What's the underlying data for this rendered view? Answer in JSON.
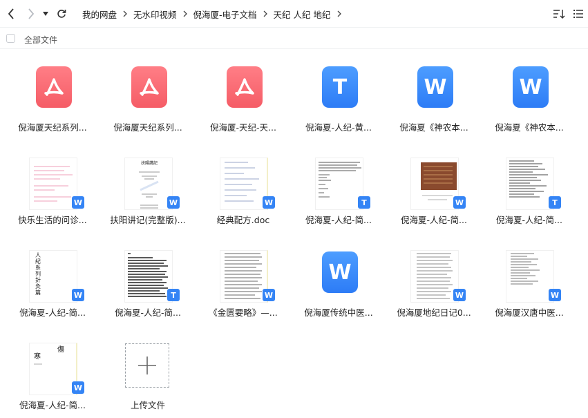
{
  "breadcrumbs": [
    "我的网盘",
    "无水印视频",
    "倪海厦-电子文档",
    "天纪 人纪 地纪"
  ],
  "select_all_label": "全部文件",
  "files": [
    {
      "name": "倪海厦天纪系列...",
      "icon": "pdf-icon"
    },
    {
      "name": "倪海厦天纪系列...",
      "icon": "pdf-icon"
    },
    {
      "name": "倪海厦-天纪-天...",
      "icon": "pdf-icon"
    },
    {
      "name": "倪海夏-人纪-黄...",
      "icon": "txt-icon"
    },
    {
      "name": "倪海夏《神农本...",
      "icon": "word-icon"
    },
    {
      "name": "倪海夏《神农本...",
      "icon": "word-icon"
    },
    {
      "name": "快乐生活的问诊...",
      "icon": "word-badge"
    },
    {
      "name": "扶阳讲记(完整版)...",
      "icon": "word-badge"
    },
    {
      "name": "经典配方.doc",
      "icon": "word-badge"
    },
    {
      "name": "倪海夏-人纪-简...",
      "icon": "txt-badge"
    },
    {
      "name": "倪海夏-人纪-简...",
      "icon": "word-badge"
    },
    {
      "name": "倪海夏-人纪-简...",
      "icon": "txt-badge"
    },
    {
      "name": "倪海夏-人纪-简...",
      "icon": "word-badge"
    },
    {
      "name": "倪海夏-人纪-简...",
      "icon": "txt-badge"
    },
    {
      "name": "《金匮要略》—...",
      "icon": "word-badge"
    },
    {
      "name": "倪海厦传统中医...",
      "icon": "word-icon"
    },
    {
      "name": "倪海厦地纪日记0...",
      "icon": "word-badge"
    },
    {
      "name": "倪海厦汉唐中医...",
      "icon": "word-badge"
    },
    {
      "name": "倪海夏-人纪-简...",
      "icon": "word-badge"
    }
  ],
  "upload_label": "上传文件",
  "preview_text": {
    "fuyang_title": "扶陽講記",
    "renji_cover": "人紀系列針灸篇",
    "shanghan_chars": [
      "傷",
      "寒"
    ]
  },
  "colors": {
    "pdf": "#f55c66",
    "word": "#2d7cf6",
    "badge": "#3484f5"
  }
}
